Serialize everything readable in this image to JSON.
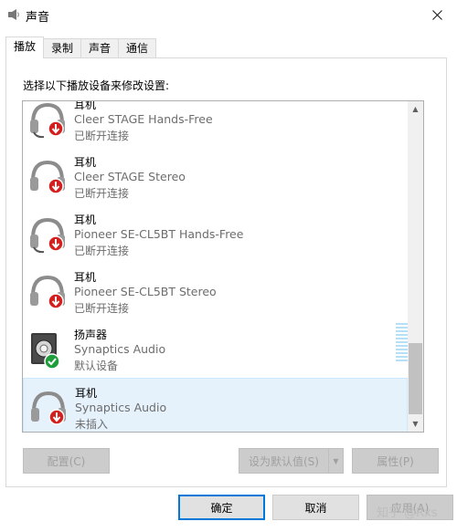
{
  "window": {
    "title": "声音"
  },
  "tabs": [
    {
      "label": "播放",
      "active": true
    },
    {
      "label": "录制",
      "active": false
    },
    {
      "label": "声音",
      "active": false
    },
    {
      "label": "通信",
      "active": false
    }
  ],
  "instruction": "选择以下播放设备来修改设置:",
  "devices": [
    {
      "name": "耳机",
      "model": "Cleer STAGE Hands-Free",
      "status": "已断开连接",
      "icon": "headset-icon",
      "badge": "disconnected"
    },
    {
      "name": "耳机",
      "model": "Cleer STAGE Stereo",
      "status": "已断开连接",
      "icon": "headphones-icon",
      "badge": "disconnected"
    },
    {
      "name": "耳机",
      "model": "Pioneer SE-CL5BT Hands-Free",
      "status": "已断开连接",
      "icon": "headset-icon",
      "badge": "disconnected"
    },
    {
      "name": "耳机",
      "model": "Pioneer SE-CL5BT Stereo",
      "status": "已断开连接",
      "icon": "headphones-icon",
      "badge": "disconnected"
    },
    {
      "name": "扬声器",
      "model": "Synaptics Audio",
      "status": "默认设备",
      "icon": "speaker-icon",
      "badge": "default"
    },
    {
      "name": "耳机",
      "model": "Synaptics Audio",
      "status": "未插入",
      "icon": "headphones-icon",
      "badge": "unplugged",
      "selected": true
    }
  ],
  "buttons": {
    "configure": "配置(C)",
    "set_default": "设为默认值(S)",
    "properties": "属性(P)",
    "ok": "确定",
    "cancel": "取消",
    "apply": "应用(A)"
  },
  "watermark": "知乎 @Rxs",
  "colors": {
    "accent": "#0078d7",
    "selected_bg": "#e5f1fb",
    "disconnected_badge": "#d41f1f",
    "default_badge": "#1e9e3a"
  }
}
